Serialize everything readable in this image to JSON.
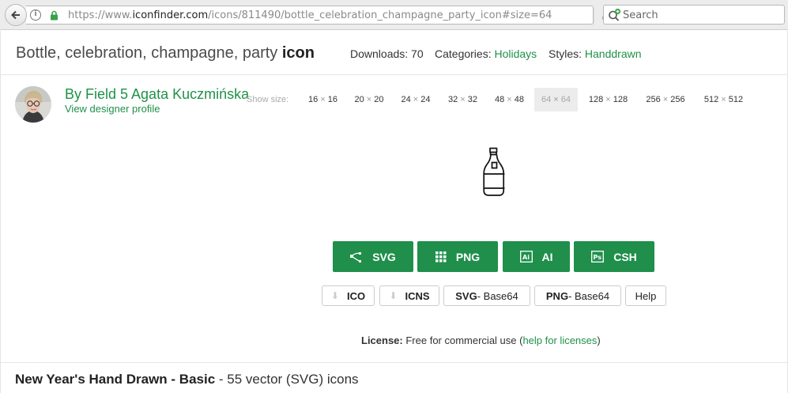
{
  "browser": {
    "url_prefix": "https://www.",
    "url_domain": "iconfinder.com",
    "url_path": "/icons/811490/bottle_celebration_champagne_party_icon#size=64",
    "search_placeholder": "Search"
  },
  "header": {
    "title_light": "Bottle, celebration, champagne, party ",
    "title_bold": "icon",
    "downloads_label": "Downloads:",
    "downloads_value": "70",
    "categories_label": "Categories:",
    "categories_value": "Holidays",
    "styles_label": "Styles:",
    "styles_value": "Handdrawn"
  },
  "designer": {
    "name": "By Field 5 Agata Kuczmińska",
    "profile_link": "View designer profile"
  },
  "sizes": {
    "label": "Show size:",
    "separator": "×",
    "options": [
      {
        "a": "16",
        "b": "16"
      },
      {
        "a": "20",
        "b": "20"
      },
      {
        "a": "24",
        "b": "24"
      },
      {
        "a": "32",
        "b": "32"
      },
      {
        "a": "48",
        "b": "48"
      },
      {
        "a": "64",
        "b": "64"
      },
      {
        "a": "128",
        "b": "128"
      },
      {
        "a": "256",
        "b": "256"
      },
      {
        "a": "512",
        "b": "512"
      }
    ],
    "selected": "64 × 64"
  },
  "downloads": {
    "primary": [
      {
        "label": "SVG",
        "icon": "vector-nodes-icon"
      },
      {
        "label": "PNG",
        "icon": "pixel-grid-icon"
      },
      {
        "label": "AI",
        "icon": "illustrator-icon"
      },
      {
        "label": "CSH",
        "icon": "photoshop-icon"
      }
    ],
    "secondary": {
      "ico": "ICO",
      "icns": "ICNS",
      "svg_b64_bold": "SVG",
      "svg_b64_rest": " - Base64",
      "png_b64_bold": "PNG",
      "png_b64_rest": " - Base64",
      "help": "Help"
    }
  },
  "license": {
    "label": "License:",
    "text": " Free for commercial use (",
    "link": "help for licenses",
    "close": ")"
  },
  "iconset": {
    "name": "New Year's Hand Drawn - Basic",
    "suffix": " - 55 vector (SVG) icons"
  },
  "colors": {
    "accent": "#1f8f4b",
    "link": "#1f9148"
  }
}
